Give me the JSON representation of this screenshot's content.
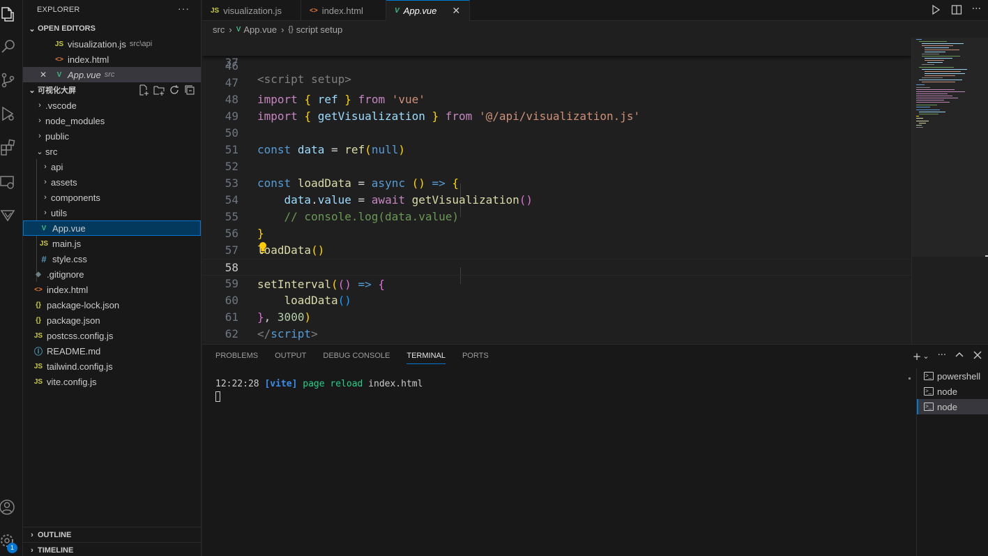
{
  "activity_bar": {
    "icons": [
      "explorer-icon",
      "search-icon",
      "source-control-icon",
      "run-debug-icon",
      "extensions-icon",
      "remote-explorer-icon",
      "vitest-icon",
      "account-icon",
      "settings-gear-icon"
    ],
    "settings_badge": "1"
  },
  "sidebar": {
    "title": "EXPLORER",
    "more": "···",
    "open_editors_label": "OPEN EDITORS",
    "open_editors": [
      {
        "icon": "JS",
        "name": "visualization.js",
        "desc": "src\\api"
      },
      {
        "icon": "<>",
        "name": "index.html",
        "desc": ""
      },
      {
        "icon": "V",
        "name": "App.vue",
        "desc": "src",
        "close": "✕"
      }
    ],
    "project_label": "可视化大屏",
    "tree": [
      {
        "chev": "›",
        "icon": "",
        "name": ".vscode"
      },
      {
        "chev": "›",
        "icon": "",
        "name": "node_modules"
      },
      {
        "chev": "›",
        "icon": "",
        "name": "public"
      },
      {
        "chev": "⌄",
        "icon": "",
        "name": "src"
      },
      {
        "chev": "›",
        "icon": "",
        "name": "api"
      },
      {
        "chev": "›",
        "icon": "",
        "name": "assets"
      },
      {
        "chev": "›",
        "icon": "",
        "name": "components"
      },
      {
        "chev": "›",
        "icon": "",
        "name": "utils"
      },
      {
        "chev": "",
        "icon": "V",
        "name": "App.vue"
      },
      {
        "chev": "",
        "icon": "JS",
        "name": "main.js"
      },
      {
        "chev": "",
        "icon": "#",
        "name": "style.css"
      },
      {
        "chev": "",
        "icon": "◆",
        "name": ".gitignore"
      },
      {
        "chev": "",
        "icon": "<>",
        "name": "index.html"
      },
      {
        "chev": "",
        "icon": "{}",
        "name": "package-lock.json"
      },
      {
        "chev": "",
        "icon": "{}",
        "name": "package.json"
      },
      {
        "chev": "",
        "icon": "JS",
        "name": "postcss.config.js"
      },
      {
        "chev": "",
        "icon": "ⓘ",
        "name": "README.md"
      },
      {
        "chev": "",
        "icon": "JS",
        "name": "tailwind.config.js"
      },
      {
        "chev": "",
        "icon": "JS",
        "name": "vite.config.js"
      }
    ],
    "outline_label": "OUTLINE",
    "timeline_label": "TIMELINE"
  },
  "tabs": [
    {
      "icon": "JS",
      "label": "visualization.js"
    },
    {
      "icon": "<>",
      "label": "index.html"
    },
    {
      "icon": "V",
      "label": "App.vue",
      "close": "✕"
    }
  ],
  "breadcrumb": {
    "folder": "src",
    "sep": "›",
    "file": "App.vue",
    "symbol_icon": "{}",
    "symbol": "script setup"
  },
  "editor": {
    "sticky": {
      "num": "37",
      "text": "<script setup>"
    },
    "lines": [
      {
        "num": "46"
      },
      {
        "num": "47"
      },
      {
        "num": "48"
      },
      {
        "num": "49"
      },
      {
        "num": "50"
      },
      {
        "num": "51"
      },
      {
        "num": "52"
      },
      {
        "num": "53"
      },
      {
        "num": "54"
      },
      {
        "num": "55"
      },
      {
        "num": "56"
      },
      {
        "num": "57"
      },
      {
        "num": "58"
      },
      {
        "num": "59"
      },
      {
        "num": "60"
      },
      {
        "num": "61"
      },
      {
        "num": "62"
      }
    ],
    "code": {
      "l47": {
        "a": "import",
        "b": "{",
        "c": "ref",
        "d": "}",
        "e": "from",
        "f": "'vue'"
      },
      "l48": {
        "a": "import",
        "b": "{",
        "c": "getVisualization",
        "d": "}",
        "e": "from",
        "f": "'@/api/visualization.js'"
      },
      "l50": {
        "a": "const",
        "b": "data",
        "c": "=",
        "d": "ref",
        "e": "(",
        "f": "null",
        "g": ")"
      },
      "l52": {
        "a": "const",
        "b": "loadData",
        "c": "=",
        "d": "async",
        "e": "()",
        "f": "=>",
        "g": "{"
      },
      "l53": {
        "a": "data",
        "b": ".",
        "c": "value",
        "d": "=",
        "e": "await",
        "f": "getVisualization",
        "g": "()"
      },
      "l54": {
        "a": "// console.log(data.value)"
      },
      "l55": {
        "a": "}"
      },
      "l56": {
        "a": "loadData",
        "b": "()"
      },
      "l58": {
        "a": "setInterval",
        "b": "(",
        "c": "()",
        "d": "=>",
        "e": "{"
      },
      "l59": {
        "a": "loadData",
        "b": "()"
      },
      "l60": {
        "a": "}",
        "b": ",",
        "c": "3000",
        "d": ")"
      },
      "l61": {
        "a": "</",
        "b": "script",
        "c": ">"
      }
    }
  },
  "panel": {
    "tabs": [
      "PROBLEMS",
      "OUTPUT",
      "DEBUG CONSOLE",
      "TERMINAL",
      "PORTS"
    ],
    "active_tab": "TERMINAL",
    "terminal_output": {
      "time": "12:22:28",
      "tag": "[vite]",
      "msg": "page reload",
      "file": "index.html"
    },
    "terminals": [
      "powershell",
      "node",
      "node"
    ],
    "active_terminal_index": 2
  },
  "colors": {
    "accent": "#0078d4",
    "background": "#1f1f1f",
    "sidebar": "#181818"
  }
}
